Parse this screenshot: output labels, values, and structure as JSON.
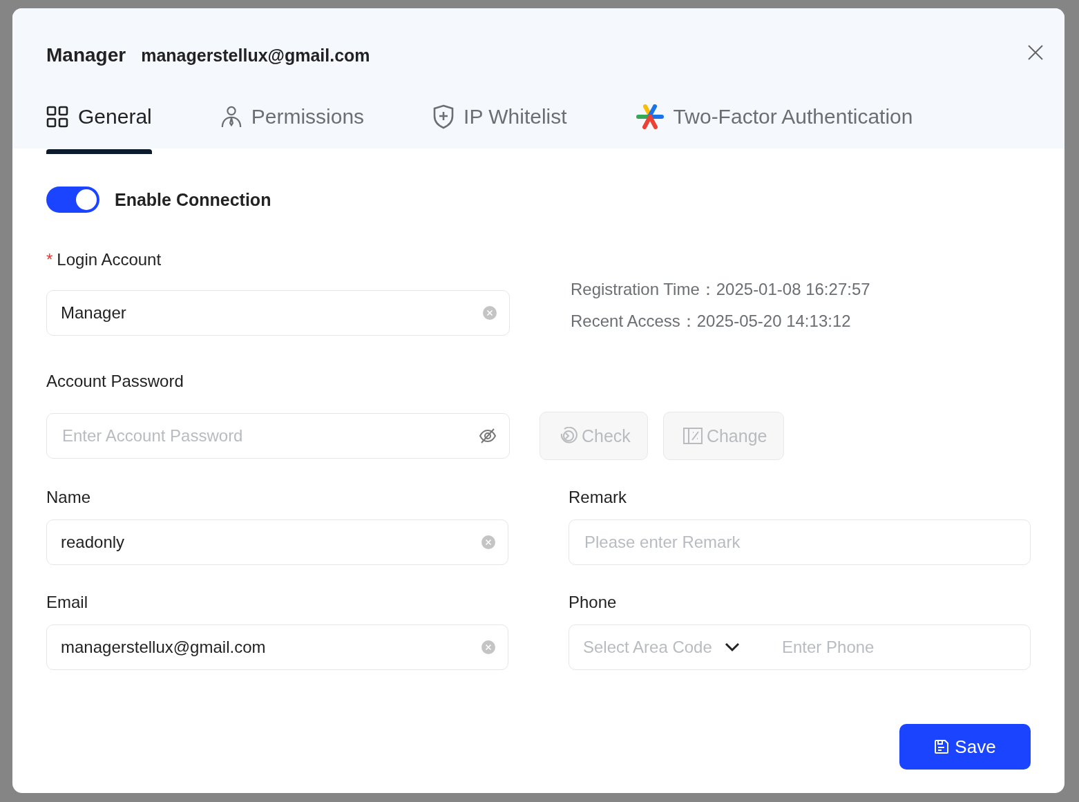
{
  "dialog": {
    "title": "Manager",
    "subtitle": "managerstellux@gmail.com"
  },
  "tabs": [
    {
      "label": "General",
      "kind": "grid",
      "selected": true
    },
    {
      "label": "Permissions",
      "kind": "person",
      "selected": false
    },
    {
      "label": "IP Whitelist",
      "kind": "shield",
      "selected": false
    },
    {
      "label": "Two-Factor Authentication",
      "kind": "star",
      "selected": false
    }
  ],
  "enable_connection": {
    "label": "Enable Connection",
    "on": true
  },
  "login_account": {
    "label": "Login Account",
    "required": true,
    "required_mark": "*",
    "value": "Manager",
    "clearable": true
  },
  "info": [
    {
      "label": "Registration Time：",
      "value": "2025-01-08 16:27:57"
    },
    {
      "label": "Recent Access：",
      "value": "2025-05-20 14:13:12"
    }
  ],
  "password": {
    "label": "Account Password",
    "placeholder": "Enter Account Password"
  },
  "password_buttons": [
    {
      "label": "Check",
      "kind": "check",
      "disabled": true
    },
    {
      "label": "Change",
      "kind": "change",
      "disabled": true
    }
  ],
  "name": {
    "label": "Name",
    "value": "readonly",
    "clearable": true
  },
  "remark": {
    "label": "Remark",
    "placeholder": "Please enter Remark"
  },
  "email": {
    "label": "Email",
    "value": "managerstellux@gmail.com",
    "clearable": true
  },
  "phone": {
    "label": "Phone",
    "area_placeholder": "Select Area Code",
    "placeholder": "Enter Phone"
  },
  "save": {
    "label": "Save"
  }
}
